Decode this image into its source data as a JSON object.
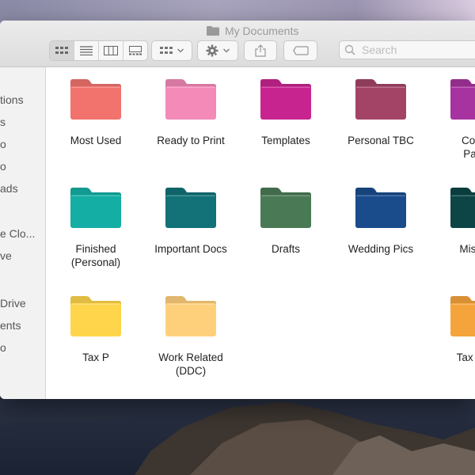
{
  "window": {
    "title": "My Documents"
  },
  "toolbar": {
    "view_buttons": [
      "icon-view",
      "list-view",
      "column-view",
      "gallery-view"
    ],
    "group_button": "group-menu",
    "action_button": "action-menu",
    "share_button": "share",
    "tags_button": "tags"
  },
  "search": {
    "placeholder": "Search"
  },
  "sidebar": {
    "items": [
      "tions",
      "s",
      "o",
      "o",
      "ads",
      "e Clo...",
      "ve",
      "Drive",
      "ents",
      "o"
    ]
  },
  "folders": [
    {
      "label": "Most Used",
      "color": "#f2736e"
    },
    {
      "label": "Ready to Print",
      "color": "#f38ab8"
    },
    {
      "label": "Templates",
      "color": "#c8248f"
    },
    {
      "label": "Personal TBC",
      "color": "#a34467"
    },
    {
      "label": "Comp\nPape",
      "color": "#a6339f"
    },
    {
      "label": "Finished\n(Personal)",
      "color": "#14aea4"
    },
    {
      "label": "Important Docs",
      "color": "#127277"
    },
    {
      "label": "Drafts",
      "color": "#4a7a55"
    },
    {
      "label": "Wedding Pics",
      "color": "#1a4c8b"
    },
    {
      "label": "Miscell",
      "color": "#0d4547"
    },
    {
      "label": "Tax P",
      "color": "#ffd64b"
    },
    {
      "label": "Work Related\n(DDC)",
      "color": "#ffd07c"
    },
    {
      "label": "Tax Pap",
      "color": "#f5a43c"
    }
  ]
}
